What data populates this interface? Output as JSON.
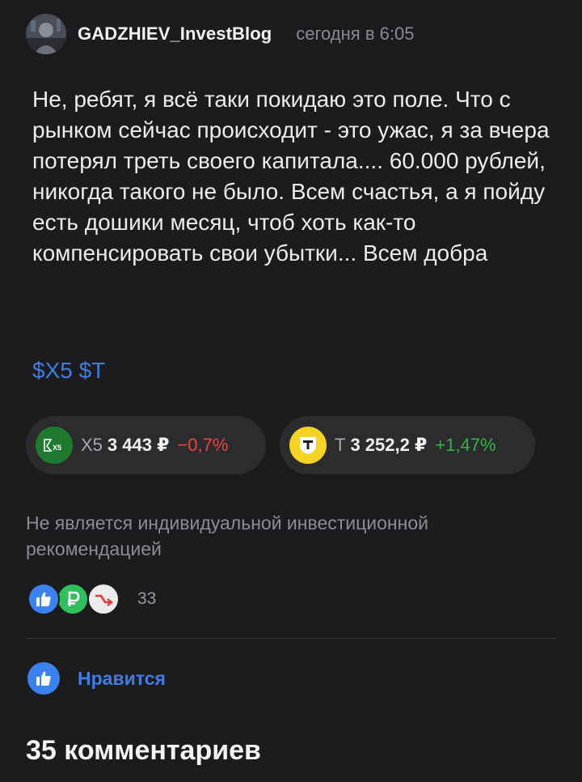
{
  "post": {
    "author": "GADZHIEV_InvestBlog",
    "time": "сегодня в 6:05",
    "text": "Не, ребят, я всё таки покидаю это поле. Что с рынком сейчас происходит - это ужас, я за вчера потерял треть своего капитала.... 60.000 рублей, никогда такого не было. Всем счастья, а я пойду есть дошики месяц, чтоб хоть как-то компенсировать свои убытки... Всем добра",
    "tickers": [
      "$X5",
      "$T"
    ]
  },
  "instruments": [
    {
      "name": "X5",
      "price": "3 443 ₽",
      "change": "−0,7%",
      "direction": "down",
      "logo_icon": "x5-logo-icon",
      "logo_text": "X5",
      "logo_color": "#1e7a2e"
    },
    {
      "name": "Т",
      "price": "3 252,2 ₽",
      "change": "+1,47%",
      "direction": "up",
      "logo_icon": "t-bank-logo-icon",
      "logo_color": "#f5d323"
    }
  ],
  "disclaimer": "Не является индивидуальной инвестиционной рекомендацией",
  "reactions": {
    "icons": [
      "thumbs-up-icon",
      "ruble-icon",
      "chart-down-icon"
    ],
    "count": "33"
  },
  "actions": {
    "like_label": "Нравится"
  },
  "comments": {
    "heading": "35 комментариев"
  },
  "colors": {
    "background": "#1c1c1e",
    "accent": "#3d7de6",
    "negative": "#f0413f",
    "positive": "#35b24a"
  }
}
